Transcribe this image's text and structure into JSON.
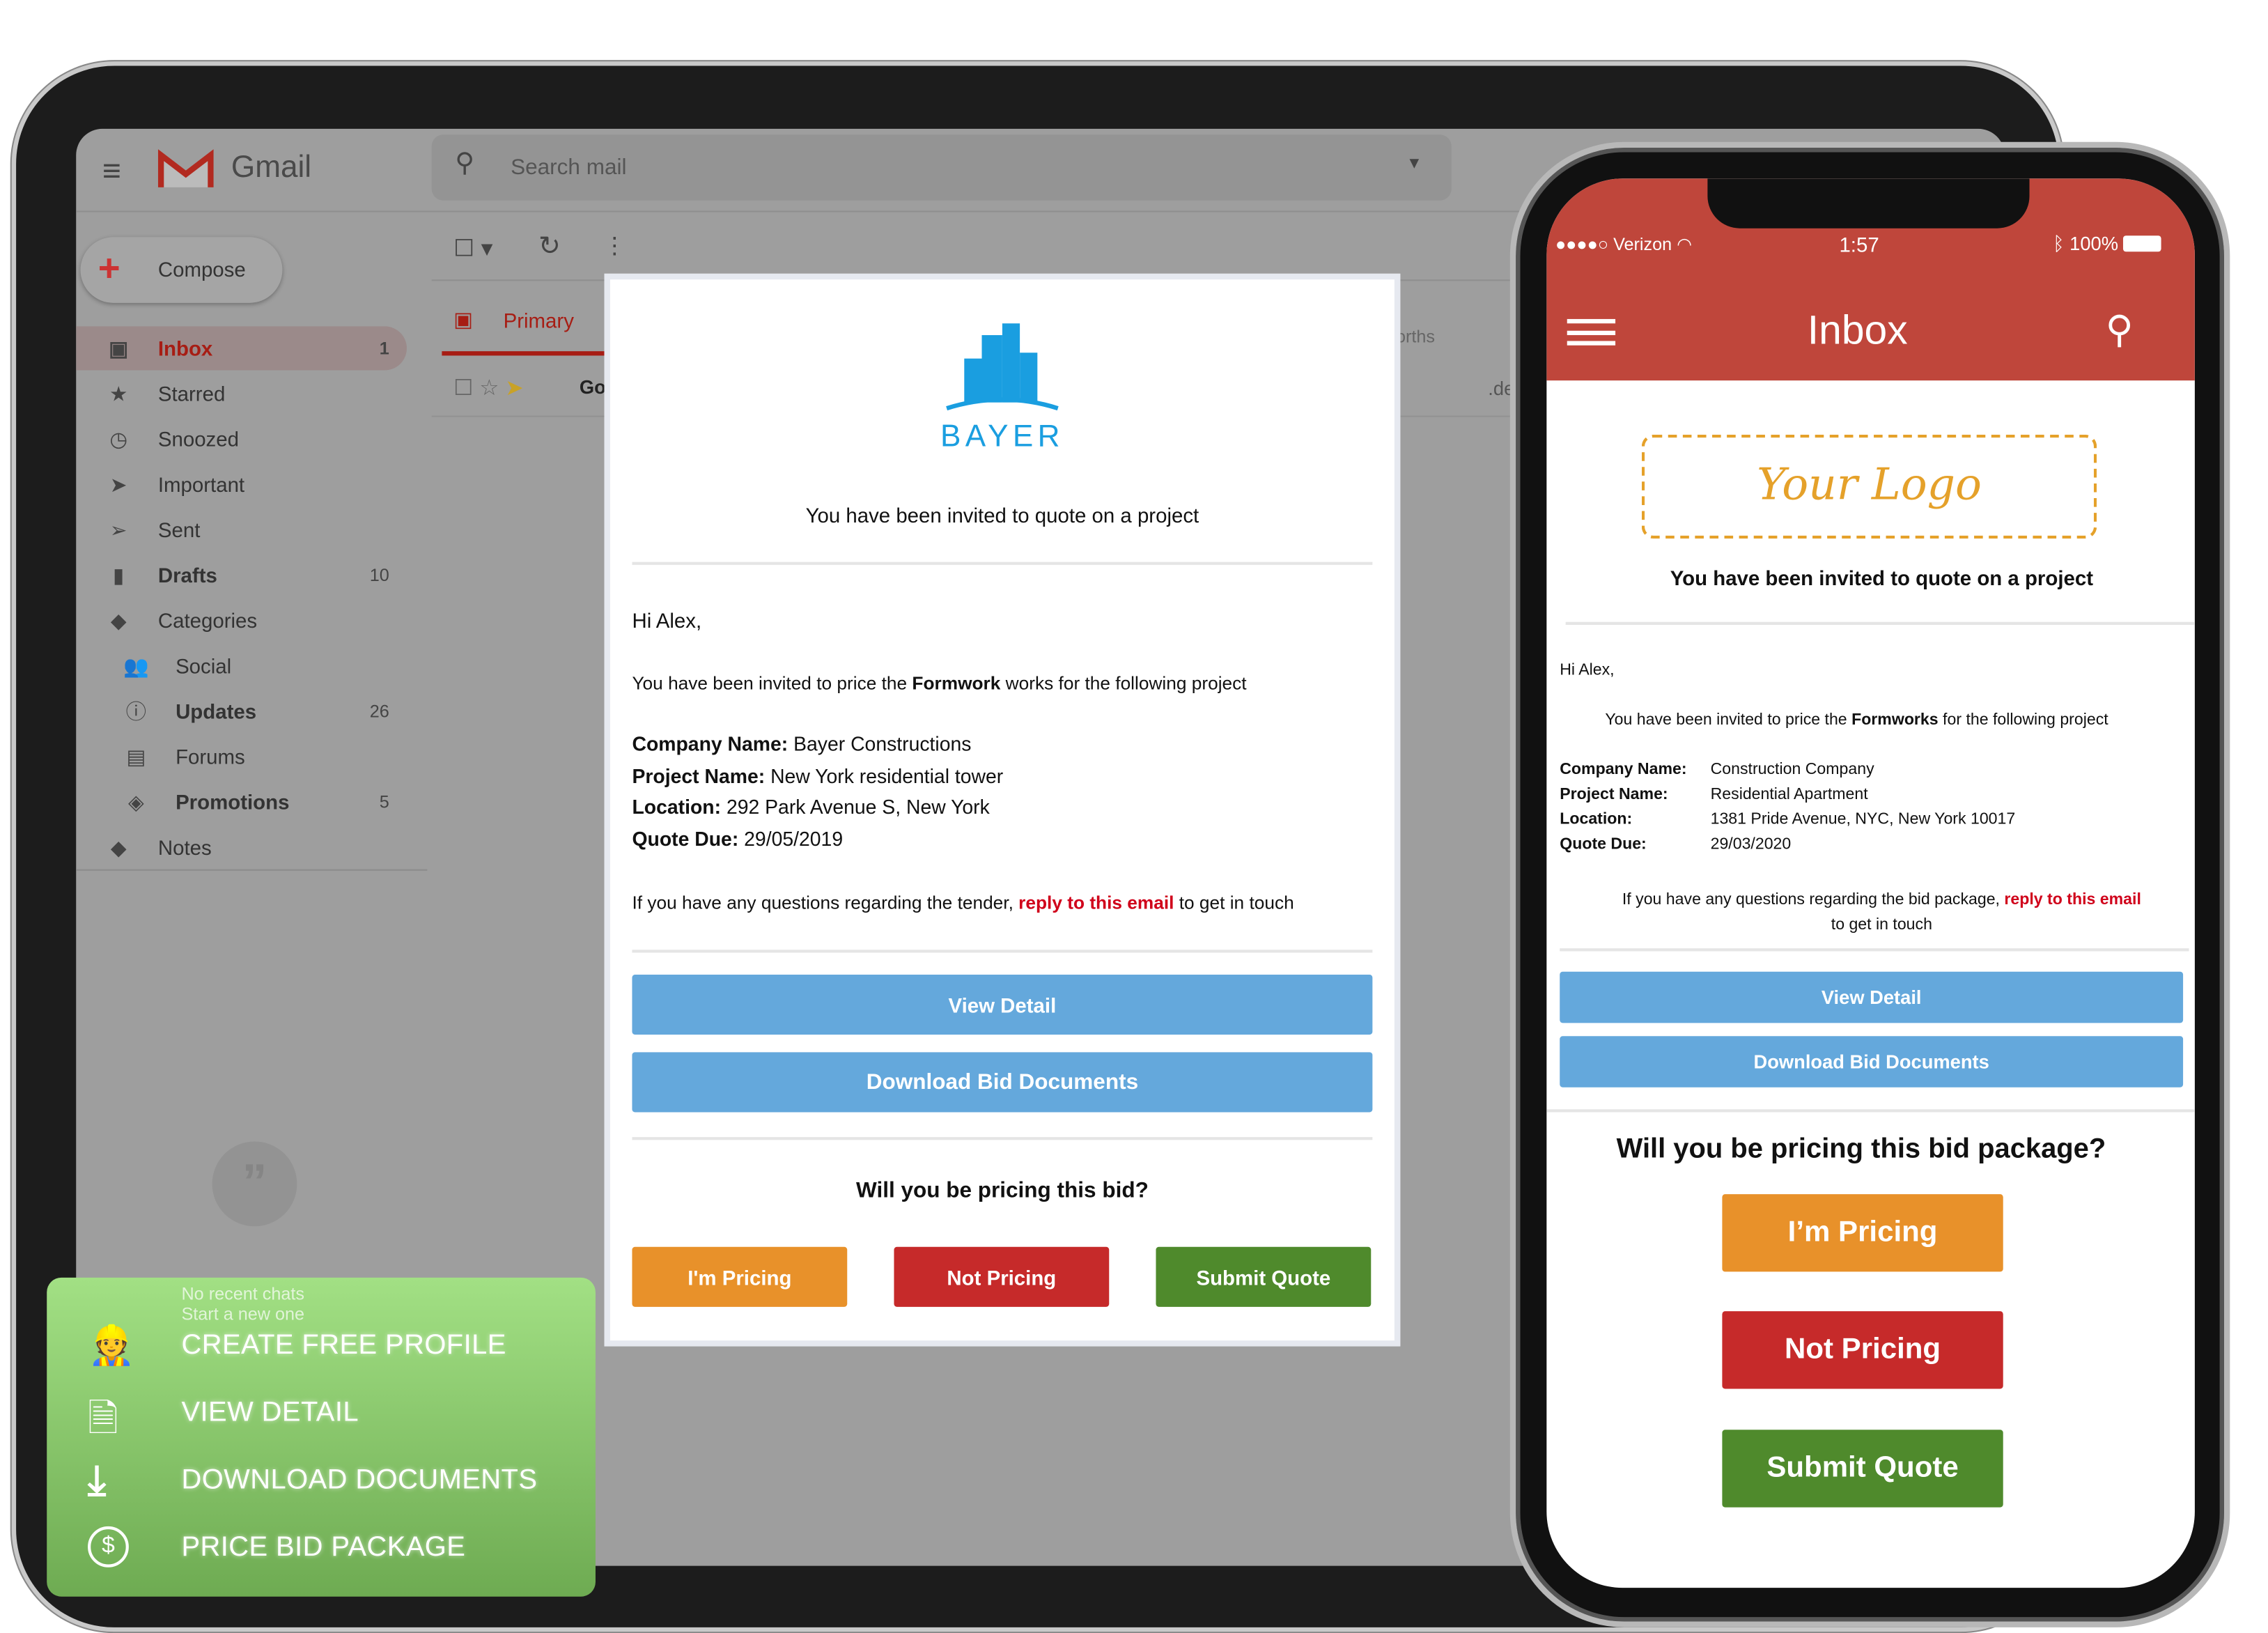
{
  "gmail": {
    "app_name": "Gmail",
    "search_placeholder": "Search mail",
    "compose_label": "Compose",
    "nav": [
      {
        "label": "Inbox",
        "count": "1",
        "icon": "inbox-icon"
      },
      {
        "label": "Starred",
        "count": "",
        "icon": "star-icon"
      },
      {
        "label": "Snoozed",
        "count": "",
        "icon": "clock-icon"
      },
      {
        "label": "Important",
        "count": "",
        "icon": "important-icon"
      },
      {
        "label": "Sent",
        "count": "",
        "icon": "send-icon"
      },
      {
        "label": "Drafts",
        "count": "10",
        "icon": "draft-icon"
      },
      {
        "label": "Categories",
        "count": "",
        "icon": "label-icon"
      },
      {
        "label": "Social",
        "count": "",
        "icon": "people-icon"
      },
      {
        "label": "Updates",
        "count": "26",
        "icon": "info-icon"
      },
      {
        "label": "Forums",
        "count": "",
        "icon": "forum-icon"
      },
      {
        "label": "Promotions",
        "count": "5",
        "icon": "tag-icon"
      },
      {
        "label": "Notes",
        "count": "",
        "icon": "label-icon"
      }
    ],
    "tab_primary": "Primary",
    "row_sender_partial": "Go",
    "partial_text_1": "orths",
    "partial_text_2": ".de",
    "chat_empty_1": "No recent chats",
    "chat_empty_2": "Start a new one"
  },
  "desktop_email": {
    "brand": "BAYER",
    "headline": "You have been invited to quote on a project",
    "greeting": "Hi Alex,",
    "intro_pre": "You have been invited to price the ",
    "intro_bold": "Formwork",
    "intro_post": " works for the following project",
    "details": [
      {
        "label": "Company Name:",
        "value": " Bayer Constructions"
      },
      {
        "label": "Project Name:",
        "value": " New York residential tower"
      },
      {
        "label": "Location:",
        "value": " 292 Park Avenue S, New York"
      },
      {
        "label": "Quote Due:",
        "value": " 29/05/2019"
      }
    ],
    "questions_pre": "If you have any questions regarding the tender, ",
    "questions_link": "reply to this email",
    "questions_post": " to get in touch",
    "view_detail": "View Detail",
    "download": "Download Bid Documents",
    "question": "Will you be pricing this bid?",
    "im_pricing": "I'm Pricing",
    "not_pricing": "Not Pricing",
    "submit_quote": "Submit Quote"
  },
  "features": [
    {
      "label": "CREATE FREE PROFILE",
      "icon": "add-worker-icon"
    },
    {
      "label": "VIEW DETAIL",
      "icon": "document-search-icon"
    },
    {
      "label": "DOWNLOAD DOCUMENTS",
      "icon": "download-icon"
    },
    {
      "label": "PRICE BID PACKAGE",
      "icon": "dollar-circle-icon"
    }
  ],
  "phone": {
    "carrier": "Verizon",
    "time": "1:57",
    "battery": "100%",
    "title": "Inbox",
    "logo_text": "Your Logo",
    "headline": "You have been invited to quote on a project",
    "greeting": "Hi Alex,",
    "intro_pre": "You have been invited to price the ",
    "intro_bold": "Formworks",
    "intro_post": " for the following project",
    "details": [
      {
        "label": "Company Name:",
        "value": "Construction Company"
      },
      {
        "label": "Project Name:",
        "value": "Residential Apartment"
      },
      {
        "label": "Location:",
        "value": "1381 Pride Avenue, NYC, New York 10017"
      },
      {
        "label": "Quote Due:",
        "value": "29/03/2020"
      }
    ],
    "questions_pre": "If you have any questions regarding the bid package, ",
    "questions_link": "reply to this email",
    "questions_post": "to get in touch",
    "view_detail": "View Detail",
    "download": "Download Bid Documents",
    "question": "Will you be pricing this bid package?",
    "im_pricing": "I’m Pricing",
    "not_pricing": "Not Pricing",
    "submit_quote": "Submit Quote"
  },
  "colors": {
    "gmail_red": "#c5221f",
    "phone_header": "#bf463b",
    "blue_button": "#64a8dc",
    "orange_button": "#e8912a",
    "red_button": "#c62a2a",
    "green_button": "#4f8a2c",
    "link_red": "#d0021b",
    "bayer_blue": "#1a9ee0"
  }
}
